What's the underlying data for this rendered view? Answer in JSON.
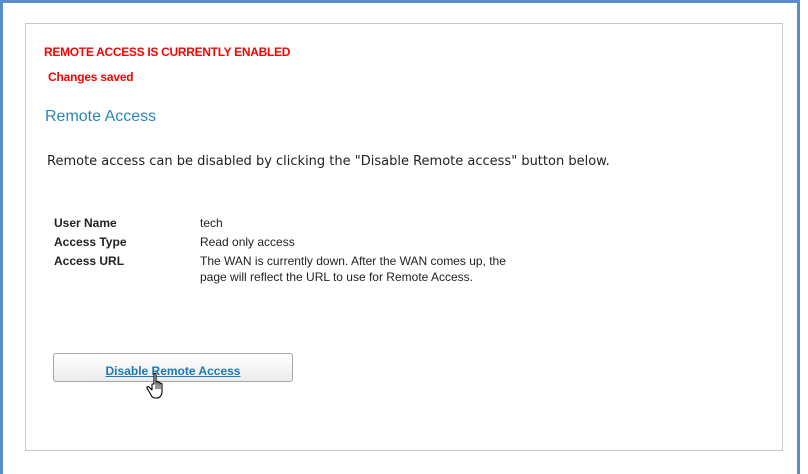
{
  "status": {
    "main": "REMOTE ACCESS IS CURRENTLY ENABLED",
    "sub": "Changes saved",
    "color": "#ff0000"
  },
  "page": {
    "title": "Remote Access",
    "description": "Remote access can be disabled by clicking the \"Disable Remote access\" button below."
  },
  "details": [
    {
      "label": "User Name",
      "value": "tech"
    },
    {
      "label": "Access Type",
      "value": "Read only access"
    },
    {
      "label": "Access URL",
      "value": "The WAN is currently down. After the WAN comes up, the page will reflect the URL to use for Remote Access."
    }
  ],
  "actions": {
    "disable_label": "Disable Remote Access"
  },
  "cursor": {
    "icon": "hand-pointer-icon"
  },
  "colors": {
    "accent": "#2a87b8",
    "link": "#1a7ab8",
    "frame": "#5b8dc8"
  }
}
